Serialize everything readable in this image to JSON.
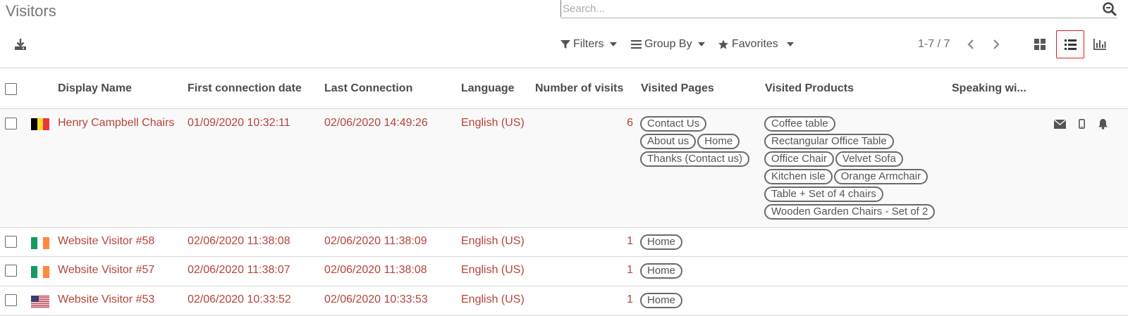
{
  "page": {
    "title": "Visitors"
  },
  "search": {
    "placeholder": "Search..."
  },
  "toolbar": {
    "filters_label": "Filters",
    "groupby_label": "Group By",
    "favorites_label": "Favorites",
    "pager": "1-7 / 7"
  },
  "views": {
    "active": "list"
  },
  "colors": {
    "link": "#b5443a",
    "active_border": "#e02020"
  },
  "table": {
    "columns": [
      "Display Name",
      "First connection date",
      "Last Connection",
      "Language",
      "Number of visits",
      "Visited Pages",
      "Visited Products",
      "Speaking wi..."
    ],
    "rows": [
      {
        "flag": "belgium",
        "name": "Henry Campbell Chairs",
        "first": "01/09/2020 10:32:11",
        "last": "02/06/2020 14:49:26",
        "language": "English (US)",
        "visits": "6",
        "pages": [
          "Contact Us",
          "About us",
          "Home",
          "Thanks (Contact us)"
        ],
        "products": [
          "Coffee table",
          "Rectangular Office Table",
          "Office Chair",
          "Velvet Sofa",
          "Kitchen isle",
          "Orange Armchair",
          "Table + Set of 4 chairs",
          "Wooden Garden Chairs - Set of 2"
        ]
      },
      {
        "flag": "ireland",
        "name": "Website Visitor #58",
        "first": "02/06/2020 11:38:08",
        "last": "02/06/2020 11:38:09",
        "language": "English (US)",
        "visits": "1",
        "pages": [
          "Home"
        ],
        "products": []
      },
      {
        "flag": "ireland",
        "name": "Website Visitor #57",
        "first": "02/06/2020 11:38:07",
        "last": "02/06/2020 11:38:08",
        "language": "English (US)",
        "visits": "1",
        "pages": [
          "Home"
        ],
        "products": []
      },
      {
        "flag": "usa",
        "name": "Website Visitor #53",
        "first": "02/06/2020 10:33:52",
        "last": "02/06/2020 10:33:53",
        "language": "English (US)",
        "visits": "1",
        "pages": [
          "Home"
        ],
        "products": []
      }
    ]
  }
}
